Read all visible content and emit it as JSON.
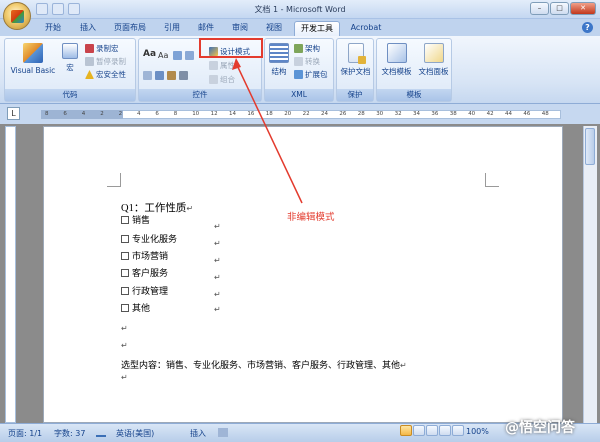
{
  "window": {
    "title": "文档 1 - Microsoft Word",
    "minimize": "–",
    "maximize": "□",
    "close": "✕"
  },
  "tabs": [
    "开始",
    "插入",
    "页面布局",
    "引用",
    "邮件",
    "审阅",
    "视图",
    "开发工具",
    "Acrobat"
  ],
  "active_tab": "开发工具",
  "ribbon": {
    "code": {
      "label": "代码",
      "visual_basic": "Visual Basic",
      "macros": "宏",
      "record_macro": "录制宏",
      "pause_recording": "暂停录制",
      "macro_security": "宏安全性"
    },
    "controls": {
      "label": "控件",
      "aa_large": "Aa",
      "aa_small": "Aa",
      "design_mode": "设计模式",
      "properties": "属性",
      "group": "组合"
    },
    "xml": {
      "label": "XML",
      "structure": "结构",
      "schema": "架构",
      "transform": "转换",
      "expansion_pack": "扩展包"
    },
    "protect": {
      "label": "保护",
      "protect_document": "保护文档"
    },
    "templates": {
      "label": "模板",
      "document_template": "文档模板",
      "document_panel": "文档面板"
    }
  },
  "ruler_marks": [
    "8",
    "6",
    "4",
    "2",
    "2",
    "4",
    "6",
    "8",
    "10",
    "12",
    "14",
    "16",
    "18",
    "20",
    "22",
    "24",
    "26",
    "28",
    "30",
    "32",
    "34",
    "36",
    "38",
    "40",
    "42",
    "44",
    "46",
    "48"
  ],
  "document": {
    "question": "Q1：工作性质",
    "options": [
      "销售",
      "专业化服务",
      "市场营销",
      "客户服务",
      "行政管理",
      "其他"
    ],
    "summary": "选型内容：销售、专业化服务、市场营销、客户服务、行政管理、其他",
    "para_mark": "↵"
  },
  "annotation": "非编辑模式",
  "statusbar": {
    "page": "页面: 1/1",
    "words": "字数: 37",
    "language": "英语(美国)",
    "mode": "插入",
    "zoom": "100%"
  },
  "watermark": "@悟空问答",
  "colors": {
    "annotation": "#e33b2e",
    "ribbon_text": "#15428b"
  }
}
